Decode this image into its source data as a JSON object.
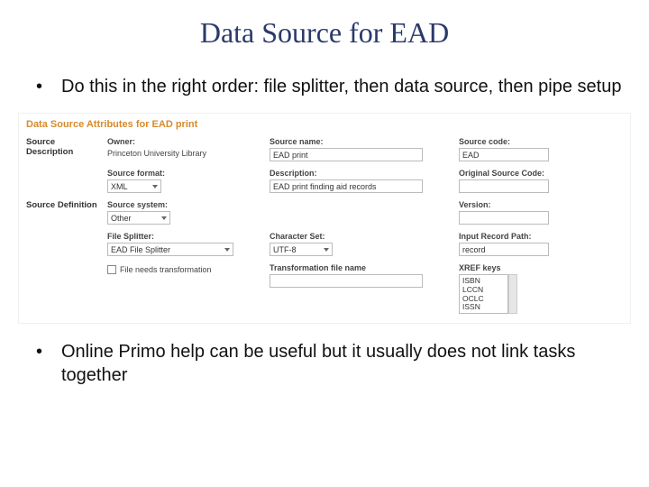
{
  "title": "Data Source for EAD",
  "bullet1": "Do this in the right order: file splitter, then data source, then pipe setup",
  "bullet2": "Online Primo help can be useful but it usually does not link tasks together",
  "form": {
    "heading": "Data Source Attributes for EAD print",
    "sections": {
      "desc": "Source Description",
      "def": "Source Definition"
    },
    "labels": {
      "owner": "Owner:",
      "source_name": "Source name:",
      "source_code": "Source code:",
      "source_format": "Source format:",
      "description": "Description:",
      "original_source_code": "Original Source Code:",
      "source_system": "Source system:",
      "version": "Version:",
      "file_splitter": "File Splitter:",
      "character_set": "Character Set:",
      "input_record_path": "Input Record Path:",
      "file_needs_transform": "File needs transformation",
      "transform_file": "Transformation file name",
      "xref_keys": "XREF keys"
    },
    "values": {
      "owner": "Princeton University Library",
      "source_name": "EAD print",
      "source_code": "EAD",
      "source_format": "XML",
      "description": "EAD print finding aid records",
      "source_system": "Other",
      "file_splitter": "EAD File Splitter",
      "character_set": "UTF-8",
      "input_record_path": "record",
      "xref": [
        "ISBN",
        "LCCN",
        "OCLC",
        "ISSN"
      ]
    }
  }
}
